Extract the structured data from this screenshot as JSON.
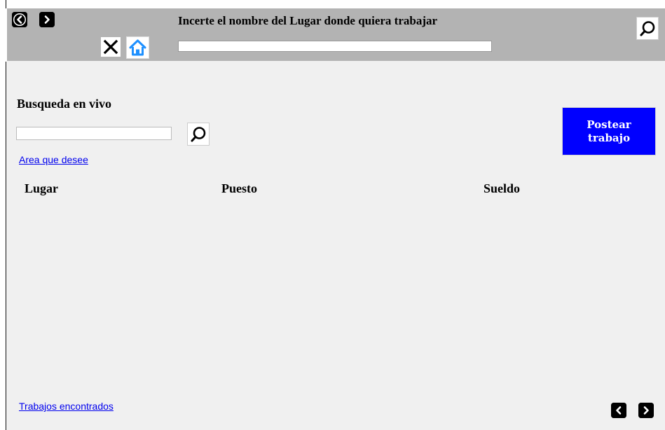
{
  "header": {
    "back_icon": "chevron-left-icon",
    "forward_icon": "chevron-right-icon",
    "close_icon": "close-icon",
    "home_icon": "home-icon",
    "search_icon": "search-icon",
    "title": "Incerte el nombre del Lugar donde quiera trabajar",
    "place_input_value": ""
  },
  "live_search": {
    "title": "Busqueda en vivo",
    "input_value": "",
    "search_icon": "search-icon",
    "area_link": "Area que desee"
  },
  "post_button": {
    "label": "Postear\ntrabajo",
    "color": "#0000ff"
  },
  "table": {
    "columns": [
      "Lugar",
      "Puesto",
      "Sueldo"
    ],
    "rows": []
  },
  "footer": {
    "found_link": "Trabajos encontrados",
    "prev_icon": "chevron-left-icon",
    "next_icon": "chevron-right-icon"
  },
  "colors": {
    "header_bg": "#b3b3b3",
    "content_bg": "#f0f0f0",
    "link": "#0000ee",
    "home_icon": "#1e90ff"
  }
}
